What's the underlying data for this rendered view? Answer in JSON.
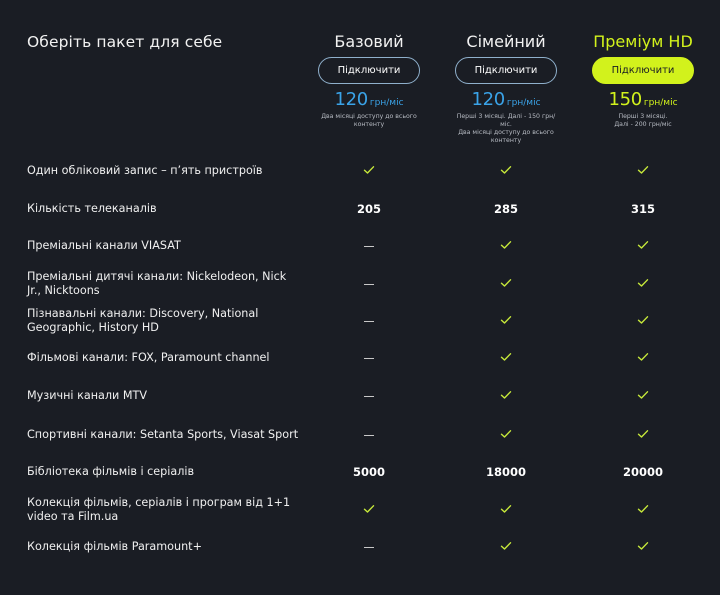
{
  "title": "Оберіть пакет для себе",
  "colors": {
    "background": "#1a1d24",
    "accent_lime": "#d2f21c",
    "accent_blue": "#3aa3e8",
    "check": "#c6e83a"
  },
  "plans": [
    {
      "name": "Базовий",
      "button": "Підключити",
      "price": "120",
      "unit": "грн/міс",
      "note": "Два місяці доступу до всього\nконтенту"
    },
    {
      "name": "Сімейний",
      "button": "Підключити",
      "price": "120",
      "unit": "грн/міс",
      "note": "Перші 3 місяці. Далі - 150 грн/\nміс.\nДва місяці доступу до всього\nконтенту"
    },
    {
      "name": "Преміум HD",
      "button": "Підключити",
      "price": "150",
      "unit": "грн/міс",
      "note": "Перші 3 місяці.\nДалі - 200 грн/міс"
    }
  ],
  "features": [
    {
      "label": "Один обліковий запис – п’ять пристроїв",
      "values": [
        "check",
        "check",
        "check"
      ]
    },
    {
      "label": "Кількість телеканалів",
      "values": [
        "205",
        "285",
        "315"
      ]
    },
    {
      "label": "Преміальні канали VIASAT",
      "values": [
        "dash",
        "check",
        "check"
      ]
    },
    {
      "label": "Преміальні дитячі канали: Nickelodeon, Nick Jr., Nicktoons",
      "values": [
        "dash",
        "check",
        "check"
      ]
    },
    {
      "label": "Пізнавальні канали: Discovery, National Geographic, History HD",
      "values": [
        "dash",
        "check",
        "check"
      ]
    },
    {
      "label": "Фільмові канали: FOX, Paramount channel",
      "values": [
        "dash",
        "check",
        "check"
      ]
    },
    {
      "label": "Музичні канали MTV",
      "values": [
        "dash",
        "check",
        "check"
      ]
    },
    {
      "label": "Спортивні канали: Setanta Sports, Viasat Sport",
      "values": [
        "dash",
        "check",
        "check"
      ]
    },
    {
      "label": "Бібліотека фільмів і серіалів",
      "values": [
        "5000",
        "18000",
        "20000"
      ]
    },
    {
      "label": "Колекція фільмів, серіалів і програм від 1+1 video та Film.ua",
      "values": [
        "check",
        "check",
        "check"
      ]
    },
    {
      "label": "Колекція фільмів Paramount+",
      "values": [
        "dash",
        "check",
        "check"
      ]
    }
  ]
}
